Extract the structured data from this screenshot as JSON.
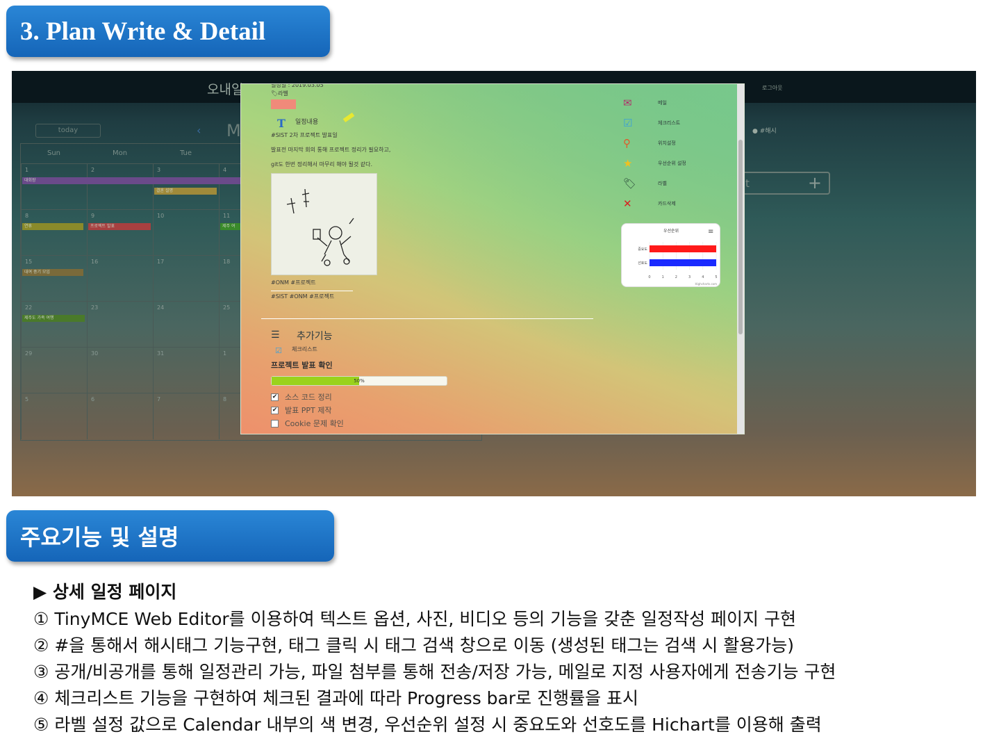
{
  "headers": {
    "section3": "3. Plan Write & Detail",
    "features": "주요기능 및 설명"
  },
  "app": {
    "brand": "오내일",
    "logout": "로그아웃",
    "today": "today",
    "nav_prev": "‹",
    "month_partial": "M",
    "side_tag": "● #해시",
    "add_box_text": "t",
    "add_box_plus": "+",
    "weekdays": [
      "Sun",
      "Mon",
      "Tue"
    ],
    "weeks": [
      [
        "1",
        "2",
        "3",
        "4"
      ],
      [
        "8",
        "9",
        "10",
        "11"
      ],
      [
        "15",
        "16",
        "17",
        "18"
      ],
      [
        "22",
        "23",
        "24",
        "25"
      ],
      [
        "29",
        "30",
        "31",
        "1"
      ],
      [
        "5",
        "6",
        "7",
        "8"
      ]
    ],
    "events": {
      "w1_bar": "대회장",
      "w1_tue": "결혼 설명",
      "w2_sun": "연휴",
      "w2_mon": "프로젝트 발표",
      "w2_wed": "제주 여",
      "w3_sun": "대여 중기 모임",
      "w4_sun": "제주도 가족 여행"
    }
  },
  "modal": {
    "date_line": "일정일 : 2019.03.05",
    "label_title": "라벨",
    "content_title": "일정내용",
    "content_lines": [
      "#SIST 2차 프로젝트 발표일",
      "발표전 마지막 회의 통해 프로젝트 정리가 필요하고,",
      "git도 한번 정리해서 마무리 해야 될것 같다."
    ],
    "tags_line1": "#ONM #프로젝트",
    "tags_line2": "#SIST #ONM #프로젝트",
    "section_title": "추가기능",
    "checklist_label": "체크리스트",
    "checklist_title": "프로젝트 발표 확인",
    "progress": 50,
    "progress_text": "50%",
    "check_items": [
      {
        "label": "소스 코드 정리",
        "checked": true
      },
      {
        "label": "발표 PPT 제작",
        "checked": true
      },
      {
        "label": "Cookie 문제 확인",
        "checked": false
      }
    ],
    "side_menu": [
      {
        "icon": "mail-icon",
        "label": "메일"
      },
      {
        "icon": "checklist-icon",
        "label": "체크리스트"
      },
      {
        "icon": "location-icon",
        "label": "위치설정"
      },
      {
        "icon": "star-icon",
        "label": "우선순위 설정"
      },
      {
        "icon": "tag-icon",
        "label": "라벨"
      },
      {
        "icon": "delete-icon",
        "label": "카드삭제"
      }
    ],
    "menu_icon_colors": {
      "mail": "#b0306a",
      "checklist": "#3aa0d8",
      "location": "#e05a2a",
      "star": "#f0c020",
      "tag": "#2a4a3a",
      "delete": "#d82020"
    }
  },
  "chart_data": {
    "type": "bar",
    "orientation": "horizontal",
    "title": "우선순위",
    "categories": [
      "중요도",
      "선호도"
    ],
    "values": [
      5,
      5
    ],
    "colors": [
      "#ff1a1a",
      "#1a2aff"
    ],
    "xlim": [
      0,
      5
    ],
    "ticks": [
      0,
      1,
      2,
      3,
      4,
      5
    ],
    "credit": "Highcharts.com"
  },
  "description": {
    "heading": "▶ 상세 일정 페이지",
    "items": [
      "① TinyMCE Web Editor를 이용하여 텍스트 옵션, 사진, 비디오 등의 기능을 갖춘 일정작성 페이지 구현",
      "② #을 통해서 해시태그 기능구현, 태그 클릭 시 태그 검색 창으로 이동 (생성된 태그는 검색 시 활용가능)",
      "③ 공개/비공개를 통해 일정관리 가능, 파일 첨부를 통해 전송/저장 가능, 메일로 지정 사용자에게 전송기능 구현",
      "④ 체크리스트 기능을 구현하여 체크된 결과에 따라 Progress bar로 진행률을 표시",
      "⑤ 라벨 설정 값으로 Calendar 내부의 색 변경, 우선순위 설정 시 중요도와 선호도를 Hichart를 이용해 출력"
    ]
  }
}
